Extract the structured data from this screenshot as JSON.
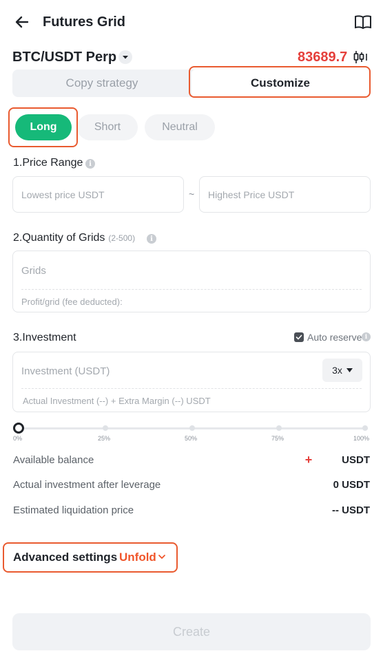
{
  "header": {
    "title": "Futures Grid",
    "back_icon": "back-arrow-icon",
    "guide_icon": "book-icon"
  },
  "pair": {
    "name": "BTC/USDT Perp",
    "price": "83689.7",
    "price_color": "#e5403b",
    "dropdown_icon": "caret-down-icon",
    "chart_icon": "candlestick-icon"
  },
  "mode_tabs": {
    "copy": "Copy strategy",
    "customize": "Customize",
    "selected": "Customize"
  },
  "direction_tabs": {
    "long": "Long",
    "short": "Short",
    "neutral": "Neutral",
    "selected": "Long",
    "accent_color": "#16b979"
  },
  "price_range": {
    "label": "1.Price Range",
    "lowest_placeholder": "Lowest price USDT",
    "separator": "~",
    "highest_placeholder": "Highest Price USDT"
  },
  "grids": {
    "label": "2.Quantity of Grids",
    "range_hint": "(2-500)",
    "placeholder": "Grids",
    "profit_note": "Profit/grid (fee deducted):"
  },
  "investment": {
    "label": "3.Investment",
    "auto_reserve_label": "Auto reserve",
    "auto_reserve_checked": true,
    "placeholder": "Investment (USDT)",
    "leverage": "3x",
    "note": "Actual Investment (--) + Extra Margin  (--) USDT"
  },
  "slider": {
    "value_percent": 0,
    "ticks": [
      "0%",
      "25%",
      "50%",
      "75%",
      "100%"
    ]
  },
  "summary": {
    "available_balance_label": "Available balance",
    "available_balance_value": "USDT",
    "actual_investment_label": "Actual investment after leverage",
    "actual_investment_value": "0 USDT",
    "liquidation_label": "Estimated liquidation price",
    "liquidation_value": "-- USDT"
  },
  "advanced": {
    "label": "Advanced settings",
    "unfold": "Unfold",
    "accent_color": "#f0552a"
  },
  "create_button": "Create"
}
